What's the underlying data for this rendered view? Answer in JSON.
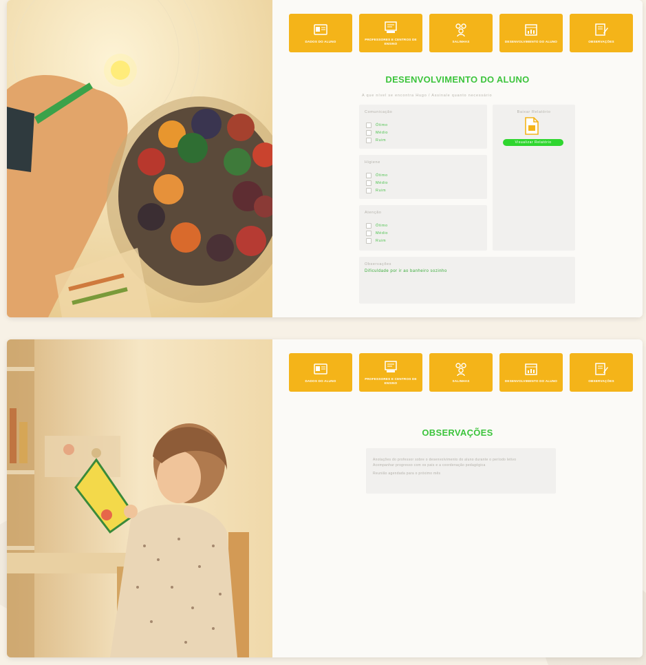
{
  "colors": {
    "accent": "#f4b419",
    "title_green": "#3cc43c",
    "button_green": "#2fd62f"
  },
  "nav": {
    "tiles": [
      {
        "label": "Dados do Aluno",
        "icon": "id-card-icon"
      },
      {
        "label": "Professores e Centros de Ensino",
        "icon": "school-board-icon"
      },
      {
        "label": "Salinhas",
        "icon": "people-group-icon"
      },
      {
        "label": "Desenvolvimento do Aluno",
        "icon": "calendar-chart-icon"
      },
      {
        "label": "Observações",
        "icon": "notepad-pen-icon"
      }
    ]
  },
  "development": {
    "title": "DESENVOLVIMENTO DO ALUNO",
    "instruction": "A que nível se encontra Hugo / Assinale quanto necessário",
    "sections": [
      {
        "heading": "Comunicação",
        "options": [
          "Ótimo",
          "Médio",
          "Ruim"
        ]
      },
      {
        "heading": "Higiene",
        "options": [
          "Ótimo",
          "Médio",
          "Ruim"
        ]
      },
      {
        "heading": "Atenção",
        "options": [
          "Ótimo",
          "Médio",
          "Ruim"
        ]
      }
    ],
    "report": {
      "heading": "Baixar Relatório",
      "icon": "pdf-document-icon",
      "button": "Visualizar Relatório"
    },
    "observations": {
      "heading": "Observações",
      "text": "Dificuldade por ir ao banheiro sozinho"
    }
  },
  "observations_page": {
    "title": "OBSERVAÇÕES",
    "lines": [
      "Anotações do professor sobre o desenvolvimento do aluno durante o período letivo",
      "Acompanhar progresso com os pais e a coordenação pedagógica",
      "Reunião agendada para o próximo mês"
    ]
  }
}
